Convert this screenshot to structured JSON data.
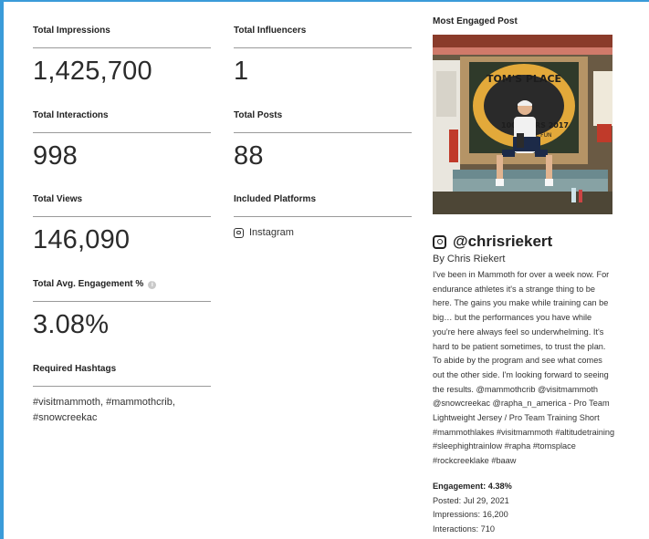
{
  "metrics": {
    "total_impressions": {
      "label": "Total Impressions",
      "value": "1,425,700"
    },
    "total_influencers": {
      "label": "Total Influencers",
      "value": "1"
    },
    "total_interactions": {
      "label": "Total Interactions",
      "value": "998"
    },
    "total_posts": {
      "label": "Total Posts",
      "value": "88"
    },
    "total_views": {
      "label": "Total Views",
      "value": "146,090"
    },
    "included_platforms": {
      "label": "Included Platforms",
      "platform": "Instagram"
    },
    "total_avg_engagement": {
      "label": "Total Avg. Engagement %",
      "value": "3.08%"
    },
    "required_hashtags": {
      "label": "Required Hashtags",
      "value": "#visitmammoth, #mammothcrib, #snowcreekac"
    }
  },
  "post": {
    "heading": "Most Engaged Post",
    "handle": "@chrisriekert",
    "byline": "By Chris Riekert",
    "caption": "I've been in Mammoth for over a week now. For endurance athletes it's a strange thing to be here. The gains you make while training can be big… but the performances you have while you're here always feel so underwhelming. It's hard to be patient sometimes, to trust the plan. To abide by the program and see what comes out the other side. I'm looking forward to seeing the results. @mammothcrib @visitmammoth @snowcreekac @rapha_n_america - Pro Team Lightweight Jersey / Pro Team Training Short #mammothlakes #visitmammoth #altitudetraining #sleephightrainlow #rapha #tomsplace #rockcreeklake #baaw",
    "engagement": "Engagement: 4.38%",
    "posted": "Posted: Jul 29, 2021",
    "impressions": "Impressions: 16,200",
    "interactions": "Interactions: 710",
    "sign_text": "TOM'S PLACE",
    "sign_years": "100 YEARS 2017",
    "sign_fun": "ALL FUN",
    "icons": {
      "platform": "instagram-icon",
      "info": "info-icon"
    }
  },
  "colors": {
    "frame": "#3a9bd9",
    "divider": "#9a9a9a",
    "text": "#222222"
  }
}
